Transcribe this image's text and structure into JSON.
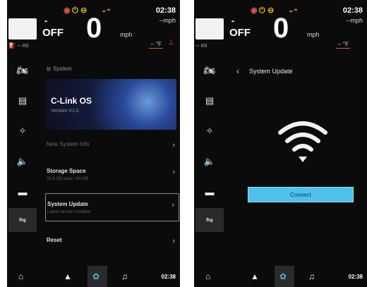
{
  "status_bar": {
    "time": "02:38",
    "speed_unit_top": "--mph",
    "icons": [
      "warning-icon",
      "battery-icon",
      "engine-icon",
      "oil-icon"
    ]
  },
  "cluster": {
    "cruise_state": "OFF",
    "speed": "0",
    "speed_unit": "mph",
    "fuel_range": "-- mi",
    "temperature": "-- °F"
  },
  "sidebar": {
    "items": [
      "motorcycle-icon",
      "storage-icon",
      "satellite-icon",
      "volume-icon",
      "display-icon",
      "settings-sliders-icon"
    ],
    "active_index": 5
  },
  "system_screen": {
    "heading": "System",
    "banner_title": "C-Link OS",
    "banner_subtitle": "Version V1.0",
    "rows": [
      {
        "title": "New System Info",
        "subtitle": ""
      },
      {
        "title": "Storage Space",
        "subtitle": "23.9 GB used / 64 GB"
      },
      {
        "title": "System Update",
        "subtitle": "Latest version installed"
      },
      {
        "title": "Reset",
        "subtitle": ""
      }
    ],
    "selected_row": 2
  },
  "update_screen": {
    "title": "System Update",
    "connect_label": "Connect"
  },
  "bottom_bar": {
    "items": [
      "home-icon",
      "navigation-icon",
      "settings-icon",
      "music-icon"
    ],
    "active_index": 2,
    "time": "02:38"
  },
  "colors": {
    "accent": "#4fc1eb",
    "background": "#0b0b0b",
    "warning_red": "#d9534f",
    "warning_yellow": "#e5c100"
  }
}
